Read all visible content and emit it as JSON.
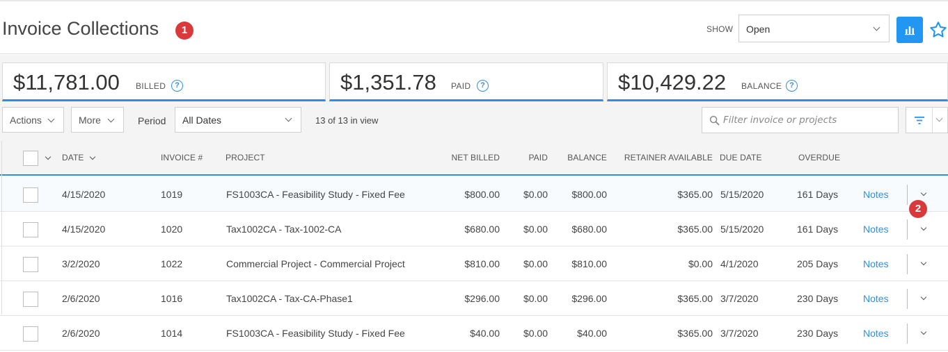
{
  "header": {
    "title": "Invoice Collections",
    "title_badge": "1",
    "show_label": "SHOW",
    "show_value": "Open"
  },
  "summary": {
    "billed": {
      "amount": "$11,781.00",
      "label": "BILLED"
    },
    "paid": {
      "amount": "$1,351.78",
      "label": "PAID"
    },
    "balance": {
      "amount": "$10,429.22",
      "label": "BALANCE"
    },
    "help_glyph": "?"
  },
  "toolbar": {
    "actions_label": "Actions",
    "more_label": "More",
    "period_label": "Period",
    "period_value": "All Dates",
    "in_view": "13 of 13 in view",
    "filter_placeholder": "Filter invoice or projects"
  },
  "table": {
    "headers": {
      "date": "DATE",
      "invoice": "INVOICE #",
      "project": "PROJECT",
      "net_billed": "NET BILLED",
      "paid": "PAID",
      "balance": "BALANCE",
      "retainer": "RETAINER AVAILABLE",
      "due_date": "DUE DATE",
      "overdue": "OVERDUE"
    },
    "notes_label": "Notes",
    "rows": [
      {
        "date": "4/15/2020",
        "invoice": "1019",
        "project": "FS1003CA - Feasibility Study - Fixed Fee",
        "net_billed": "$800.00",
        "paid": "$0.00",
        "balance": "$800.00",
        "retainer": "$365.00",
        "due_date": "5/15/2020",
        "overdue": "161 Days"
      },
      {
        "date": "4/15/2020",
        "invoice": "1020",
        "project": "Tax1002CA - Tax-1002-CA",
        "net_billed": "$680.00",
        "paid": "$0.00",
        "balance": "$680.00",
        "retainer": "$365.00",
        "due_date": "5/15/2020",
        "overdue": "161 Days"
      },
      {
        "date": "3/2/2020",
        "invoice": "1022",
        "project": "Commercial Project - Commercial Project",
        "net_billed": "$810.00",
        "paid": "$0.00",
        "balance": "$810.00",
        "retainer": "$0.00",
        "due_date": "4/1/2020",
        "overdue": "205 Days"
      },
      {
        "date": "2/6/2020",
        "invoice": "1016",
        "project": "Tax1002CA - Tax-CA-Phase1",
        "net_billed": "$296.00",
        "paid": "$0.00",
        "balance": "$296.00",
        "retainer": "$365.00",
        "due_date": "3/7/2020",
        "overdue": "230 Days"
      },
      {
        "date": "2/6/2020",
        "invoice": "1014",
        "project": "FS1003CA - Feasibility Study - Fixed Fee",
        "net_billed": "$40.00",
        "paid": "$0.00",
        "balance": "$40.00",
        "retainer": "$365.00",
        "due_date": "3/7/2020",
        "overdue": "230 Days"
      }
    ],
    "row_badge": "2"
  },
  "colors": {
    "accent": "#2196f3",
    "callout": "#d9393b",
    "link": "#2f8fe3"
  },
  "icons": [
    "bar-chart-icon",
    "star-icon",
    "help-icon",
    "search-icon",
    "filter-icon",
    "chevron-down-icon"
  ]
}
